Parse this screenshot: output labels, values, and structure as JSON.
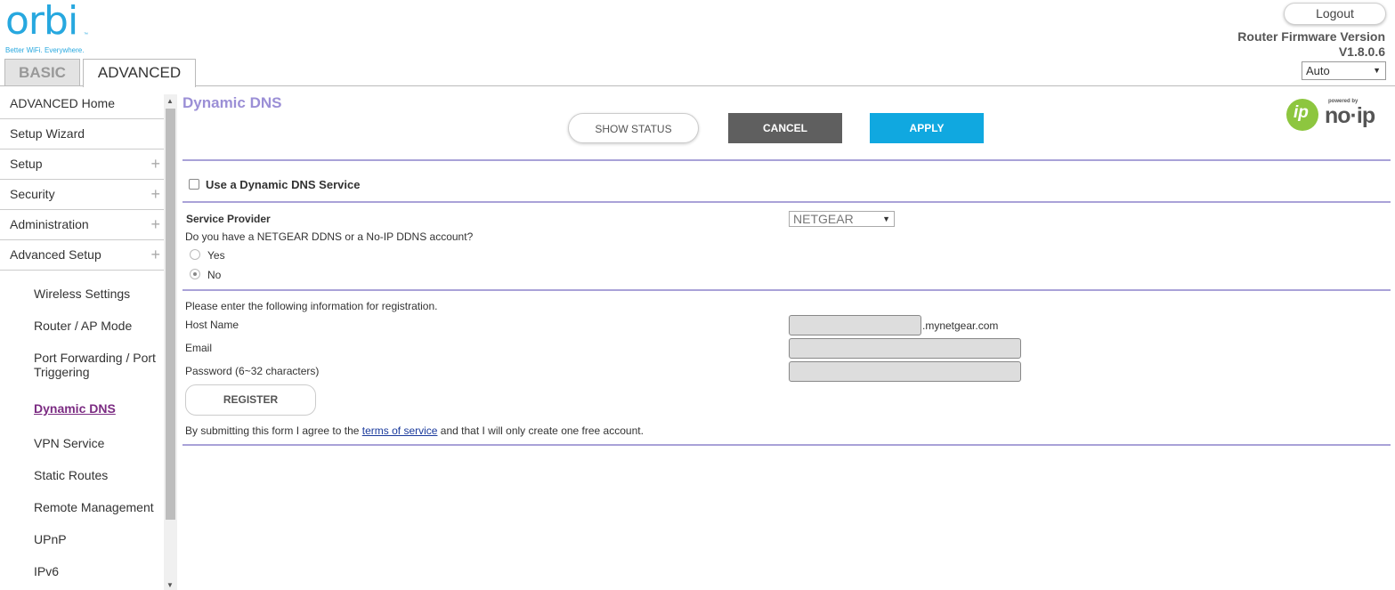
{
  "brand": {
    "logo_text": "orbi",
    "tm": "™",
    "tagline": "Better WiFi. Everywhere."
  },
  "header": {
    "logout_label": "Logout",
    "firmware_title": "Router Firmware Version",
    "firmware_version": "V1.8.0.6",
    "language_value": "Auto"
  },
  "tabs": {
    "basic": "BASIC",
    "advanced": "ADVANCED"
  },
  "sidebar": {
    "top_items": [
      {
        "label": "ADVANCED Home",
        "expandable": false
      },
      {
        "label": "Setup Wizard",
        "expandable": false
      },
      {
        "label": "Setup",
        "expandable": true
      },
      {
        "label": "Security",
        "expandable": true
      },
      {
        "label": "Administration",
        "expandable": true
      },
      {
        "label": "Advanced Setup",
        "expandable": true
      }
    ],
    "plus_glyph": "+",
    "sub_items": [
      {
        "label": "Wireless Settings"
      },
      {
        "label": "Router / AP Mode"
      },
      {
        "label": "Port Forwarding / Port Triggering"
      },
      {
        "label": "Dynamic DNS",
        "active": true
      },
      {
        "label": "VPN Service"
      },
      {
        "label": "Static Routes"
      },
      {
        "label": "Remote Management"
      },
      {
        "label": "UPnP"
      },
      {
        "label": "IPv6"
      }
    ]
  },
  "main": {
    "title": "Dynamic DNS",
    "show_status_label": "SHOW STATUS",
    "cancel_label": "CANCEL",
    "apply_label": "APPLY",
    "noip_logo": {
      "powered": "powered by",
      "word": "no·ip",
      "circle_text": "ip"
    },
    "use_ddns_label": "Use a Dynamic DNS Service",
    "use_ddns_checked": false,
    "service_provider_label": "Service Provider",
    "service_provider_value": "NETGEAR",
    "account_question": "Do you have a NETGEAR DDNS or a No-IP DDNS account?",
    "radio_yes": "Yes",
    "radio_no": "No",
    "radio_selected": "No",
    "registration_prompt": "Please enter the following information for registration.",
    "host_name_label": "Host Name",
    "host_suffix": ".mynetgear.com",
    "email_label": "Email",
    "password_label": "Password (6~32 characters)",
    "register_label": "REGISTER",
    "tos_prefix": "By submitting this form I agree to the ",
    "tos_link": "terms of service",
    "tos_suffix": " and that I will only create one free account."
  },
  "colors": {
    "brand_blue": "#27a8df",
    "title_purple": "#9b8fd6",
    "divider_purple": "#a9a2d8",
    "apply_blue": "#10a8e0",
    "cancel_gray": "#5f5f5f",
    "active_menu": "#7b2b82",
    "noip_green": "#8dc63f"
  }
}
